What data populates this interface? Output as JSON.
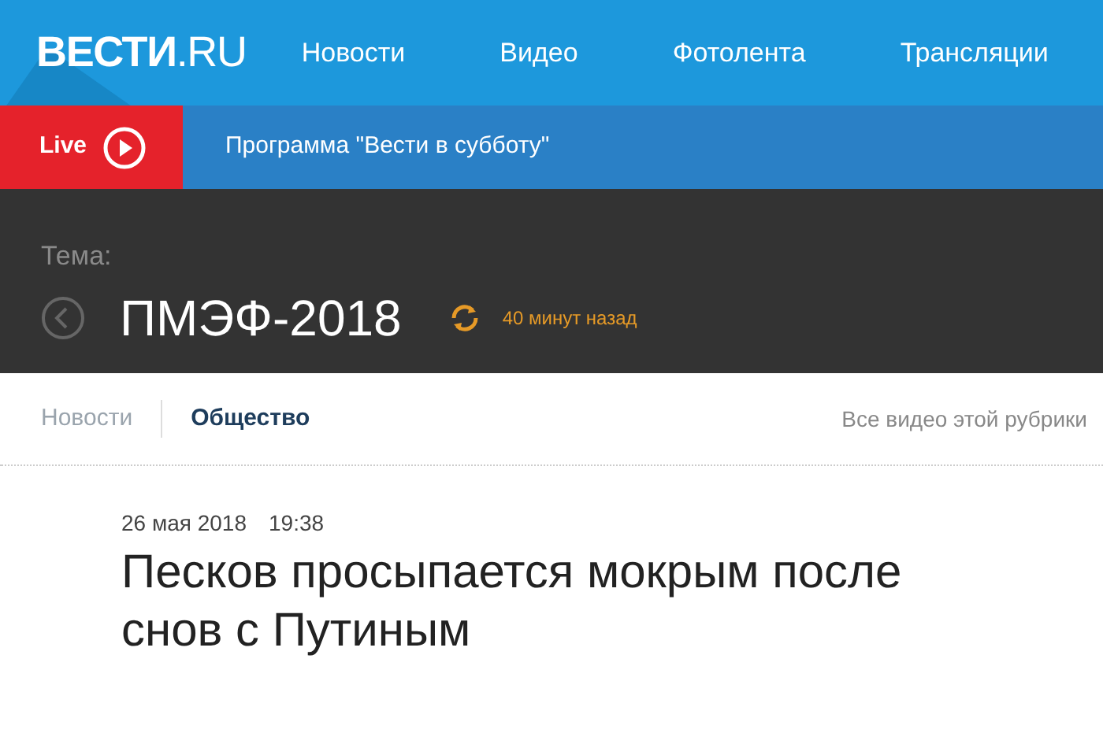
{
  "header": {
    "logo": "**ВЕСТИ**.RU",
    "nav": [
      {
        "label": "Новости"
      },
      {
        "label": "Видео"
      },
      {
        "label": "Фотолента"
      },
      {
        "label": "Трансляции"
      }
    ]
  },
  "live_bar": {
    "badge": "Live",
    "program": "Программа \"Вести в субботу\""
  },
  "topic": {
    "label": "Тема:",
    "title": "ПМЭФ-2018",
    "updated": "40 минут назад"
  },
  "breadcrumbs": [
    {
      "label": "Новости",
      "selected": false
    },
    {
      "label": "Общество",
      "selected": true
    }
  ],
  "all_videos_link": "Все видео этой рубрики",
  "article": {
    "date": "26 мая 2018",
    "time": "19:38",
    "headline": "Песков просыпается мокрым после снов с Путиным"
  }
}
